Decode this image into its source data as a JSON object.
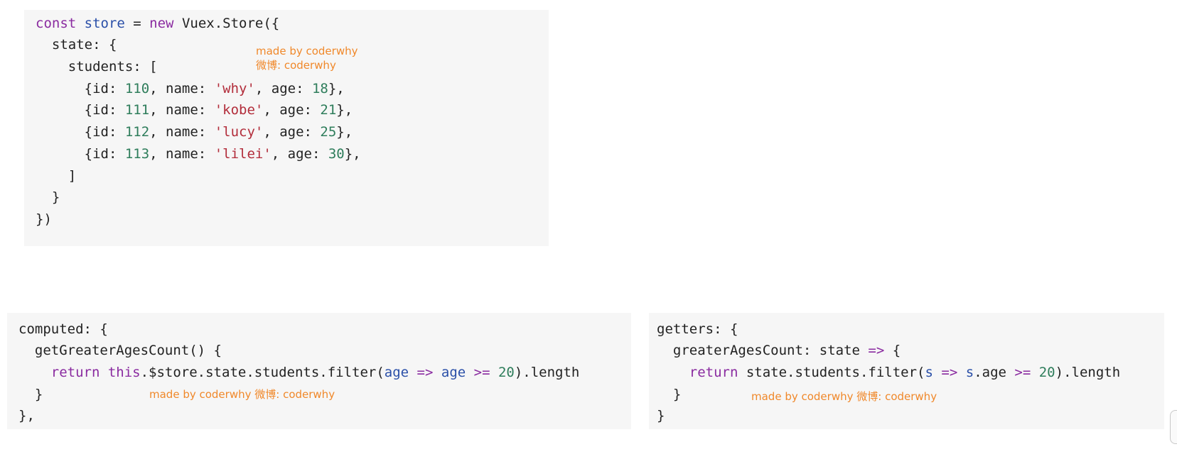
{
  "store_block": {
    "lines": [
      [
        {
          "t": "const ",
          "c": "kw"
        },
        {
          "t": "store",
          "c": "vb"
        },
        {
          "t": " = ",
          "c": "pl"
        },
        {
          "t": "new",
          "c": "kw"
        },
        {
          "t": " Vuex.Store({",
          "c": "pl"
        }
      ],
      [
        {
          "t": "  state: {",
          "c": "pl"
        }
      ],
      [
        {
          "t": "    students: [",
          "c": "pl"
        }
      ],
      [
        {
          "t": "      {id: ",
          "c": "pl"
        },
        {
          "t": "110",
          "c": "nm"
        },
        {
          "t": ", name: ",
          "c": "pl"
        },
        {
          "t": "'why'",
          "c": "st"
        },
        {
          "t": ", age: ",
          "c": "pl"
        },
        {
          "t": "18",
          "c": "nm"
        },
        {
          "t": "},",
          "c": "pl"
        }
      ],
      [
        {
          "t": "      {id: ",
          "c": "pl"
        },
        {
          "t": "111",
          "c": "nm"
        },
        {
          "t": ", name: ",
          "c": "pl"
        },
        {
          "t": "'kobe'",
          "c": "st"
        },
        {
          "t": ", age: ",
          "c": "pl"
        },
        {
          "t": "21",
          "c": "nm"
        },
        {
          "t": "},",
          "c": "pl"
        }
      ],
      [
        {
          "t": "      {id: ",
          "c": "pl"
        },
        {
          "t": "112",
          "c": "nm"
        },
        {
          "t": ", name: ",
          "c": "pl"
        },
        {
          "t": "'lucy'",
          "c": "st"
        },
        {
          "t": ", age: ",
          "c": "pl"
        },
        {
          "t": "25",
          "c": "nm"
        },
        {
          "t": "},",
          "c": "pl"
        }
      ],
      [
        {
          "t": "      {id: ",
          "c": "pl"
        },
        {
          "t": "113",
          "c": "nm"
        },
        {
          "t": ", name: ",
          "c": "pl"
        },
        {
          "t": "'lilei'",
          "c": "st"
        },
        {
          "t": ", age: ",
          "c": "pl"
        },
        {
          "t": "30",
          "c": "nm"
        },
        {
          "t": "},",
          "c": "pl"
        }
      ],
      [
        {
          "t": "    ]",
          "c": "pl"
        }
      ],
      [
        {
          "t": "  }",
          "c": "pl"
        }
      ],
      [
        {
          "t": "})",
          "c": "pl"
        }
      ]
    ],
    "watermark_line1": "made by coderwhy",
    "watermark_line2": "微博: coderwhy"
  },
  "computed_block": {
    "lines": [
      [
        {
          "t": "computed: {",
          "c": "pl"
        }
      ],
      [
        {
          "t": "  getGreaterAgesCount() {",
          "c": "pl"
        }
      ],
      [
        {
          "t": "    return ",
          "c": "kw"
        },
        {
          "t": "this",
          "c": "kw"
        },
        {
          "t": ".$store.state.students.filter(",
          "c": "pl"
        },
        {
          "t": "age",
          "c": "vb"
        },
        {
          "t": " => ",
          "c": "op"
        },
        {
          "t": "age",
          "c": "vb"
        },
        {
          "t": " >= ",
          "c": "op"
        },
        {
          "t": "20",
          "c": "nm"
        },
        {
          "t": ").length",
          "c": "pl"
        }
      ],
      [
        {
          "t": "  }",
          "c": "pl"
        }
      ],
      [
        {
          "t": "},",
          "c": "pl"
        }
      ]
    ],
    "watermark": "made by coderwhy  微博: coderwhy"
  },
  "getters_block": {
    "lines": [
      [
        {
          "t": "getters: {",
          "c": "pl"
        }
      ],
      [
        {
          "t": "  greaterAgesCount: state ",
          "c": "pl"
        },
        {
          "t": "=>",
          "c": "op"
        },
        {
          "t": " {",
          "c": "pl"
        }
      ],
      [
        {
          "t": "    return ",
          "c": "kw"
        },
        {
          "t": "state.students.filter(",
          "c": "pl"
        },
        {
          "t": "s",
          "c": "vb"
        },
        {
          "t": " => ",
          "c": "op"
        },
        {
          "t": "s",
          "c": "vb"
        },
        {
          "t": ".age ",
          "c": "pl"
        },
        {
          "t": ">=",
          "c": "op"
        },
        {
          "t": " ",
          "c": "pl"
        },
        {
          "t": "20",
          "c": "nm"
        },
        {
          "t": ").length",
          "c": "pl"
        }
      ],
      [
        {
          "t": "  }",
          "c": "pl"
        }
      ],
      [
        {
          "t": "}",
          "c": "pl"
        }
      ]
    ],
    "watermark": "made by coderwhy  微博: coderwhy"
  },
  "colors": {
    "keyword": "#8a2ba0",
    "variable": "#2a4fa8",
    "string": "#b22c3a",
    "number": "#2e7d5b",
    "watermark": "#f0882a",
    "block_bg": "#f6f6f6"
  }
}
